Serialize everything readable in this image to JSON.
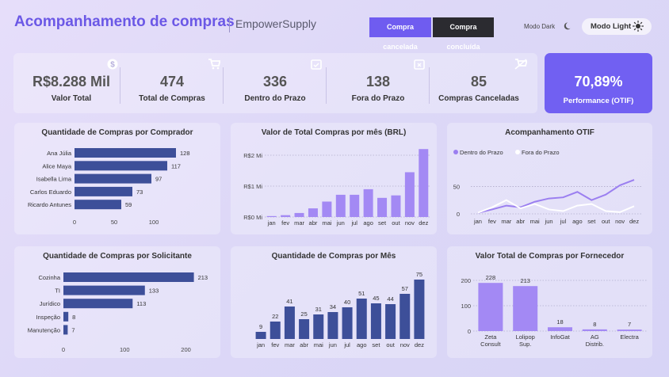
{
  "header": {
    "title": "Acompanhamento de compras",
    "brand": "EmpowerSupply",
    "btn_cancelada": "Compra cancelada",
    "btn_concluida": "Compra concluída",
    "modo_dark": "Modo Dark",
    "modo_light": "Modo Light"
  },
  "kpis": [
    {
      "value": "R$8.288 Mil",
      "label": "Valor Total",
      "icon": "dollar-icon"
    },
    {
      "value": "474",
      "label": "Total de Compras",
      "icon": "cart-icon"
    },
    {
      "value": "336",
      "label": "Dentro do Prazo",
      "icon": "calendar-check-icon"
    },
    {
      "value": "138",
      "label": "Fora do Prazo",
      "icon": "calendar-x-icon"
    },
    {
      "value": "85",
      "label": "Compras Canceladas",
      "icon": "cart-off-icon"
    }
  ],
  "otif": {
    "value": "70,89%",
    "label": "Performance (OTIF)"
  },
  "colors": {
    "primary": "#7160f2",
    "bar_purple": "#a389f4",
    "bar_navy": "#3d4f99",
    "line_purple": "#9b7ff0",
    "line_white": "#ffffff"
  },
  "chart_data": [
    {
      "type": "bar",
      "orientation": "horizontal",
      "title": "Quantidade de Compras por Comprador",
      "categories": [
        "Ana Júlia",
        "Alice Maya",
        "Isabella Lima",
        "Carlos Eduardo",
        "Ricardo Antunes"
      ],
      "values": [
        128,
        117,
        97,
        73,
        59
      ],
      "xticks": [
        "0",
        "50",
        "100"
      ],
      "xlim": [
        0,
        150
      ]
    },
    {
      "type": "bar",
      "title": "Valor de Total Compras por mês (BRL)",
      "categories": [
        "jan",
        "fev",
        "mar",
        "abr",
        "mai",
        "jun",
        "jul",
        "ago",
        "set",
        "out",
        "nov",
        "dez"
      ],
      "values": [
        0.03,
        0.06,
        0.13,
        0.28,
        0.5,
        0.72,
        0.72,
        0.9,
        0.62,
        0.7,
        1.45,
        2.2
      ],
      "yticks": [
        "R$0 Mi",
        "R$1 Mi",
        "R$2 Mi"
      ],
      "ylim": [
        0,
        2
      ],
      "unit": "Mi"
    },
    {
      "type": "line",
      "title": "Acompanhamento OTIF",
      "categories": [
        "jan",
        "fev",
        "mar",
        "abr",
        "mai",
        "jun",
        "jul",
        "ago",
        "set",
        "out",
        "nov",
        "dez"
      ],
      "series": [
        {
          "name": "Dentro do Prazo",
          "values": [
            2,
            8,
            15,
            12,
            22,
            28,
            30,
            40,
            25,
            35,
            52,
            62
          ]
        },
        {
          "name": "Fora do Prazo",
          "values": [
            2,
            12,
            25,
            10,
            18,
            8,
            5,
            15,
            18,
            5,
            3,
            14
          ]
        }
      ],
      "yticks": [
        "0",
        "50"
      ],
      "ylim": [
        0,
        75
      ]
    },
    {
      "type": "bar",
      "orientation": "horizontal",
      "title": "Quantidade de Compras por Solicitante",
      "categories": [
        "Cozinha",
        "TI",
        "Jurídico",
        "Inspeção",
        "Manutenção"
      ],
      "values": [
        213,
        133,
        113,
        8,
        7
      ],
      "xticks": [
        "0",
        "100",
        "200"
      ],
      "xlim": [
        0,
        220
      ]
    },
    {
      "type": "bar",
      "title": "Quantidade de Compras por Mês",
      "categories": [
        "jan",
        "fev",
        "mar",
        "abr",
        "mai",
        "jun",
        "jul",
        "ago",
        "set",
        "out",
        "nov",
        "dez"
      ],
      "values": [
        9,
        22,
        41,
        25,
        31,
        34,
        40,
        51,
        45,
        44,
        57,
        75
      ],
      "ylim": [
        0,
        75
      ]
    },
    {
      "type": "bar",
      "title": "Valor Total de Compras por Fornecedor",
      "categories": [
        "Zeta Consult",
        "Lolipop Sup.",
        "InfoGat",
        "AG Distrib.",
        "Electra"
      ],
      "category_lines": [
        [
          "Zeta",
          "Consult"
        ],
        [
          "Lolipop",
          "Sup."
        ],
        [
          "InfoGat"
        ],
        [
          "AG",
          "Distrib."
        ],
        [
          "Electra"
        ]
      ],
      "values": [
        228,
        213,
        18,
        8,
        7
      ],
      "yticks": [
        "0",
        "100",
        "200"
      ],
      "ylim": [
        0,
        240
      ]
    }
  ]
}
